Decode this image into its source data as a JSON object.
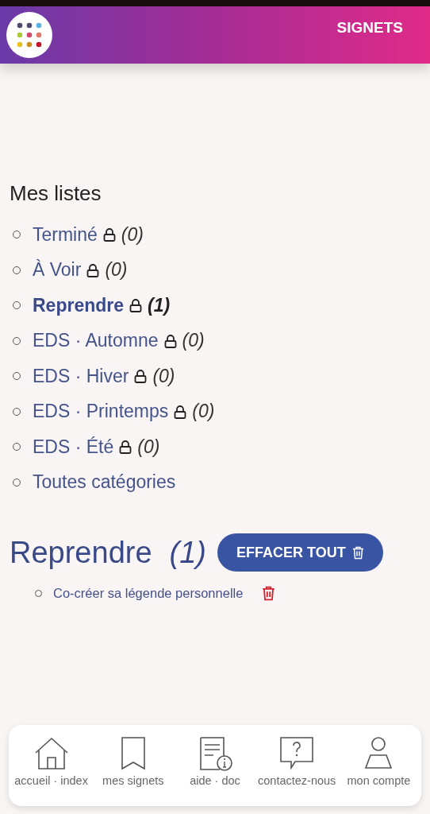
{
  "header": {
    "title": "SIGNETS"
  },
  "lists": {
    "title": "Mes listes",
    "items": [
      {
        "label": "Terminé",
        "locked": true,
        "count": "(0)",
        "selected": false
      },
      {
        "label": "À Voir",
        "locked": true,
        "count": "(0)",
        "selected": false
      },
      {
        "label": "Reprendre",
        "locked": true,
        "count": "(1)",
        "selected": true
      },
      {
        "label": "EDS · Automne",
        "locked": true,
        "count": "(0)",
        "selected": false
      },
      {
        "label": "EDS · Hiver",
        "locked": true,
        "count": "(0)",
        "selected": false
      },
      {
        "label": "EDS · Printemps",
        "locked": true,
        "count": "(0)",
        "selected": false
      },
      {
        "label": "EDS · Été",
        "locked": true,
        "count": "(0)",
        "selected": false
      },
      {
        "label": "Toutes catégories",
        "locked": false,
        "selected": false
      }
    ]
  },
  "current": {
    "title": "Reprendre",
    "count": "(1)",
    "clear_button": "EFFACER TOUT",
    "bookmarks": [
      {
        "label": "Co-créer sa légende personnelle"
      }
    ]
  },
  "bottom_nav": [
    {
      "kind": "home",
      "label": "accueil · index"
    },
    {
      "kind": "bookmark",
      "label": "mes signets"
    },
    {
      "kind": "doc",
      "label": "aide · doc"
    },
    {
      "kind": "contact",
      "label": "contactez-nous"
    },
    {
      "kind": "account",
      "label": "mon compte"
    }
  ]
}
